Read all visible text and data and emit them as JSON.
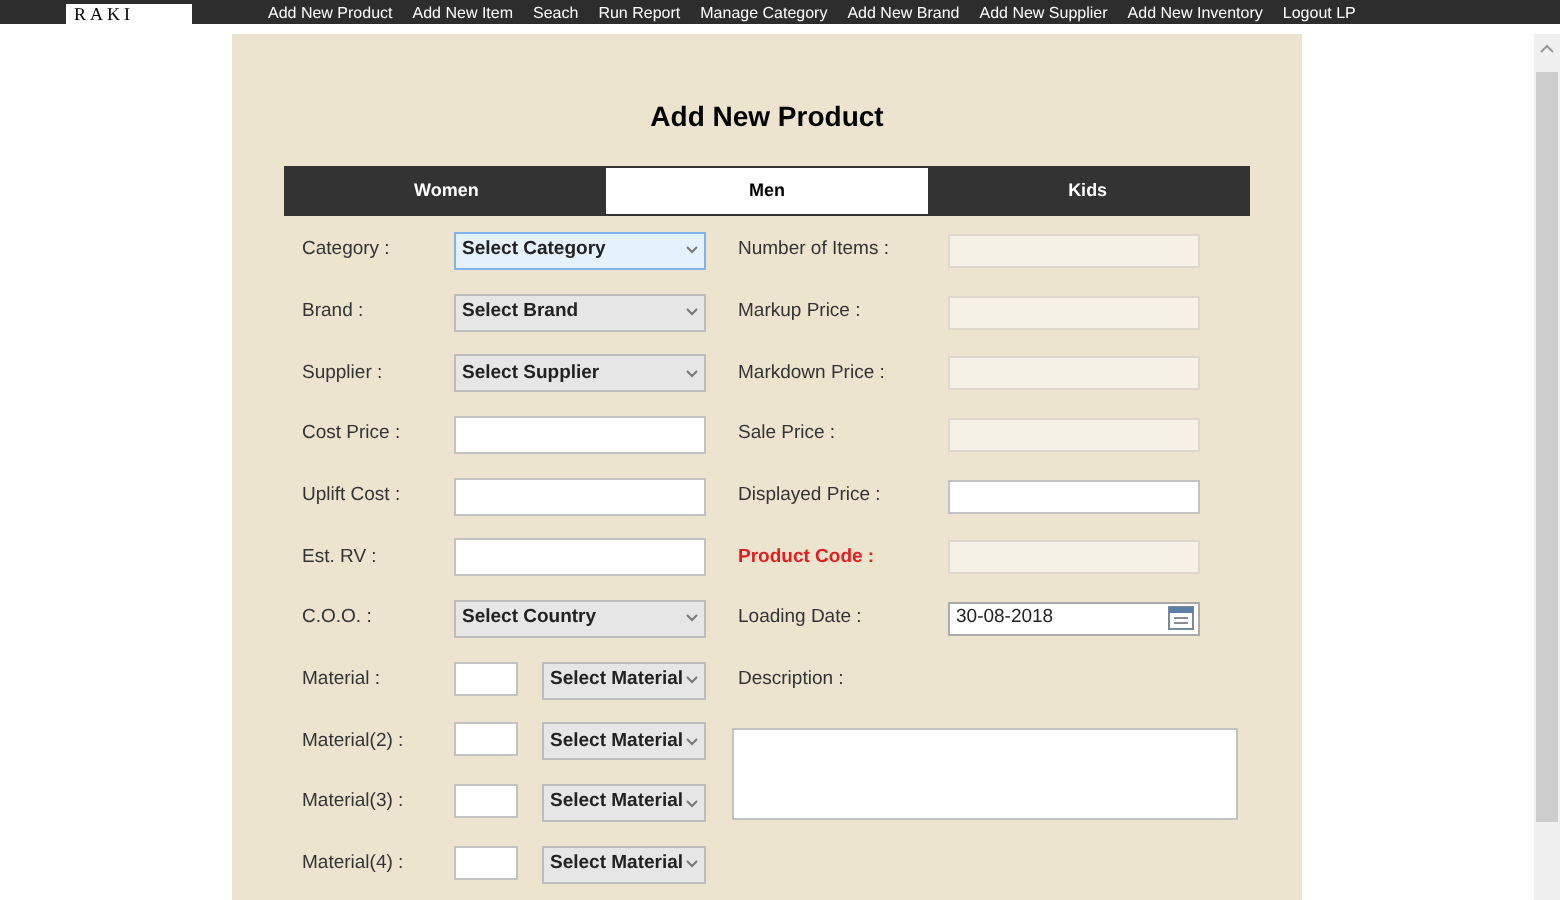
{
  "logo": {
    "text": "RAKI"
  },
  "nav": [
    "Add New Product",
    "Add New Item",
    "Seach",
    "Run Report",
    "Manage Category",
    "Add New Brand",
    "Add New Supplier",
    "Add New Inventory",
    "Logout LP"
  ],
  "title": "Add New Product",
  "tabs": [
    {
      "label": "Women",
      "selected": false
    },
    {
      "label": "Men",
      "selected": true
    },
    {
      "label": "Kids",
      "selected": false
    }
  ],
  "left_fields": [
    {
      "label": "Category :",
      "kind": "select",
      "value": "Select Category",
      "focused": true
    },
    {
      "label": "Brand :",
      "kind": "select",
      "value": "Select Brand",
      "focused": false
    },
    {
      "label": "Supplier :",
      "kind": "select",
      "value": "Select Supplier",
      "focused": false
    },
    {
      "label": "Cost Price :",
      "kind": "input"
    },
    {
      "label": "Uplift Cost :",
      "kind": "input"
    },
    {
      "label": "Est. RV :",
      "kind": "input"
    },
    {
      "label": "C.O.O. :",
      "kind": "select",
      "value": "Select Country",
      "focused": false
    },
    {
      "label": "Material :",
      "kind": "material",
      "value": "Select Material"
    },
    {
      "label": "Material(2) :",
      "kind": "material",
      "value": "Select Material"
    },
    {
      "label": "Material(3) :",
      "kind": "material",
      "value": "Select Material"
    },
    {
      "label": "Material(4) :",
      "kind": "material",
      "value": "Select Material"
    }
  ],
  "right_fields": [
    {
      "label": "Number of Items :",
      "kind": "input",
      "disabled": true,
      "highlight": false
    },
    {
      "label": "Markup Price :",
      "kind": "input",
      "disabled": true,
      "highlight": false
    },
    {
      "label": "Markdown Price :",
      "kind": "input",
      "disabled": true,
      "highlight": false
    },
    {
      "label": "Sale Price :",
      "kind": "input",
      "disabled": true,
      "highlight": false
    },
    {
      "label": "Displayed Price :",
      "kind": "input",
      "disabled": false,
      "highlight": false
    },
    {
      "label": "Product Code :",
      "kind": "input",
      "disabled": true,
      "highlight": true
    },
    {
      "label": "Loading Date :",
      "kind": "date",
      "value": "30-08-2018"
    },
    {
      "label": "Description :",
      "kind": "textarea"
    }
  ]
}
